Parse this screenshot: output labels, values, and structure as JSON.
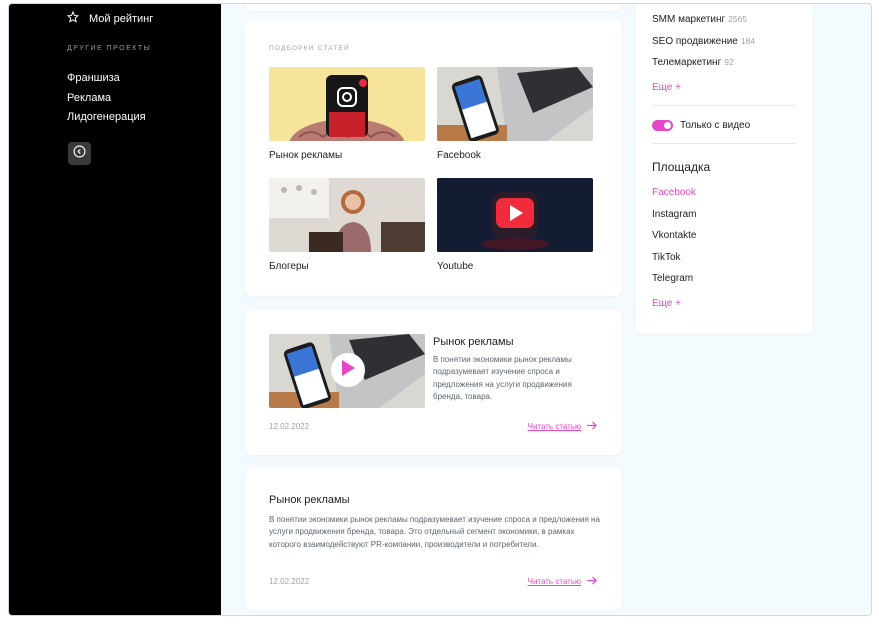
{
  "sidebar": {
    "rating_label": "Мой рейтинг",
    "section_title": "ДРУГИЕ ПРОЕКТЫ",
    "links": [
      "Франшиза",
      "Реклама",
      "Лидогенерация"
    ]
  },
  "collections": {
    "title": "ПОДБОРКИ СТАТЕЙ",
    "items": [
      "Рынок рекламы",
      "Facebook",
      "Блогеры",
      "Youtube"
    ]
  },
  "article1": {
    "title": "Рынок рекламы",
    "text": "В понятии экономики рынок рекламы подразумевает изучение спроса и предложения на услуги продвижения бренда, товара.",
    "date": "12.02.2022",
    "read_label": "Читать статью"
  },
  "article2": {
    "title": "Рынок рекламы",
    "text": "В понятии экономики рынок рекламы подразумевает изучение спроса и предложения на услуги продвижения бренда, товара. Это отдельный сегмент экономики, в рамках которого взаимодействуют PR-компании, производители и потребители.",
    "date": "12.02.2022",
    "read_label": "Читать статью"
  },
  "filters": {
    "categories": [
      {
        "label": "SMM маркетинг",
        "count": "2565"
      },
      {
        "label": "SEO продвижение",
        "count": "184"
      },
      {
        "label": "Телемаркетинг",
        "count": "92"
      }
    ],
    "more_label": "Еще +",
    "video_only_label": "Только с видео",
    "video_only_enabled": true,
    "platform_title": "Площадка",
    "platforms": [
      "Facebook",
      "Instagram",
      "Vkontakte",
      "TikTok",
      "Telegram"
    ],
    "platforms_more_label": "Еще +",
    "accent_color": "#e447c8"
  }
}
